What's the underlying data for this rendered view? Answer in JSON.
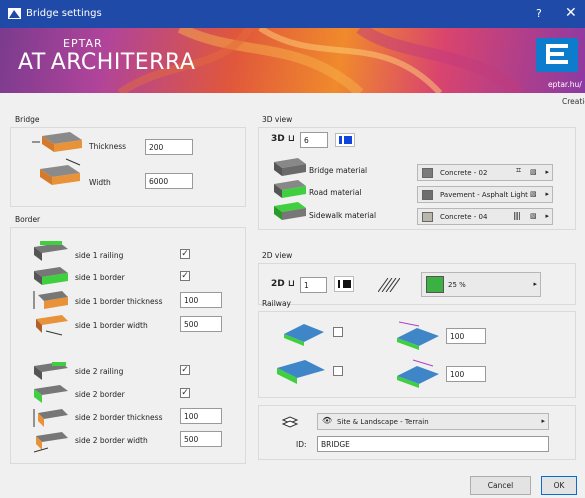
{
  "window": {
    "title": "Bridge settings",
    "help": "?",
    "close": "✕"
  },
  "banner": {
    "company": "EPTAR",
    "product": "ARCHITERRA",
    "logo_mark": "AT",
    "url": "eptar.hu/",
    "created": "Creatio"
  },
  "bridge": {
    "heading": "Bridge",
    "thickness_label": "Thickness",
    "thickness_value": "200",
    "width_label": "Width",
    "width_value": "6000"
  },
  "border": {
    "heading": "Border",
    "rows": [
      {
        "label": "side 1 railing",
        "checked": true
      },
      {
        "label": "side 1 border",
        "checked": true
      },
      {
        "label": "side 1 border thickness",
        "value": "100"
      },
      {
        "label": "side 1 border width",
        "value": "500"
      },
      {
        "label": "side 2 railing",
        "checked": true
      },
      {
        "label": "side 2 border",
        "checked": true
      },
      {
        "label": "side 2 border thickness",
        "value": "100"
      },
      {
        "label": "side 2 border width",
        "value": "500"
      }
    ]
  },
  "view3d": {
    "heading": "3D view",
    "pen_value": "6",
    "materials": [
      {
        "label": "Bridge material",
        "value": "Concrete - 02",
        "swatch": "#7a7a7a"
      },
      {
        "label": "Road material",
        "value": "Pavement - Asphalt Light",
        "swatch": "#6e6e6e"
      },
      {
        "label": "Sidewalk material",
        "value": "Concrete - 04",
        "swatch": "#b9b6ab"
      }
    ]
  },
  "view2d": {
    "heading": "2D view",
    "pen_value": "1",
    "fill_value": "25 %",
    "fill_color": "#3cb043"
  },
  "railway": {
    "heading": "Railway",
    "value_1": "100",
    "value_2": "100"
  },
  "layer": {
    "value": "Site & Landscape - Terrain",
    "id_label": "ID:",
    "id_value": "BRIDGE"
  },
  "buttons": {
    "cancel": "Cancel",
    "ok": "OK"
  }
}
